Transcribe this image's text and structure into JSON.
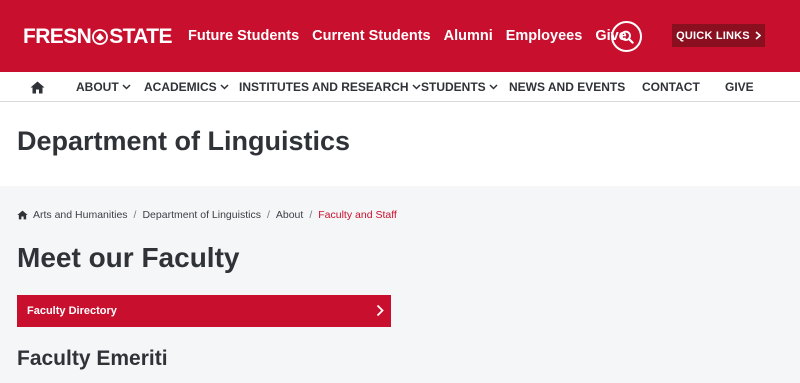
{
  "header": {
    "logo_text_left": "FRESN",
    "logo_text_right": "STATE",
    "nav": [
      "Future Students",
      "Current Students",
      "Alumni",
      "Employees",
      "Give"
    ],
    "quick_links": "QUICK LINKS"
  },
  "main_nav": {
    "items": [
      {
        "label": "ABOUT",
        "dropdown": true
      },
      {
        "label": "ACADEMICS",
        "dropdown": true
      },
      {
        "label": "INSTITUTES AND RESEARCH",
        "dropdown": true
      },
      {
        "label": "STUDENTS",
        "dropdown": true
      },
      {
        "label": "NEWS AND EVENTS",
        "dropdown": false
      },
      {
        "label": "CONTACT",
        "dropdown": false
      },
      {
        "label": "GIVE",
        "dropdown": false
      }
    ]
  },
  "page": {
    "department_title": "Department of Linguistics",
    "breadcrumb": [
      "Arts and Humanities",
      "Department of Linguistics",
      "About",
      "Faculty and Staff"
    ],
    "heading": "Meet our Faculty",
    "directory_button": "Faculty Directory",
    "subheading": "Faculty Emeriti"
  },
  "colors": {
    "brand_red": "#c8102e",
    "dark_red": "#8a1020",
    "text_dark": "#2f3237"
  }
}
